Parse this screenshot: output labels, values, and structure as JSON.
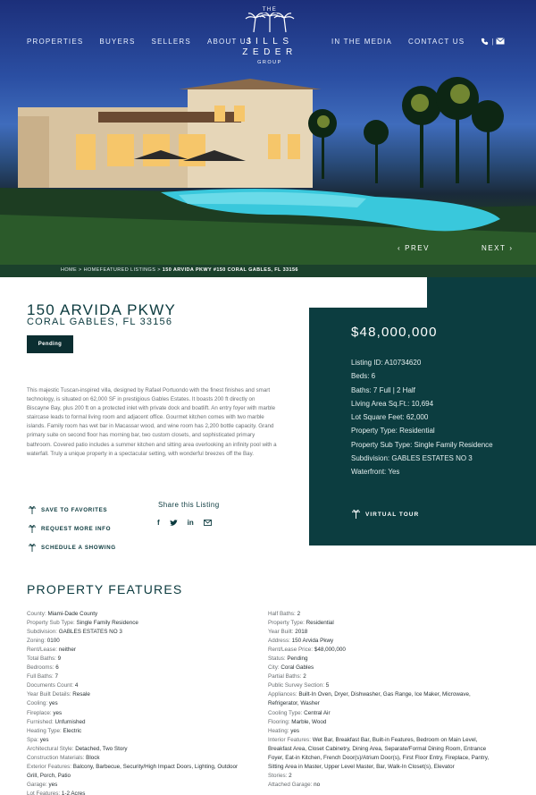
{
  "nav": {
    "left": [
      "PROPERTIES",
      "BUYERS",
      "SELLERS",
      "ABOUT US"
    ],
    "right": [
      "IN THE MEDIA",
      "CONTACT US"
    ],
    "separator": "|",
    "icons": [
      "phone-icon",
      "mail-icon"
    ]
  },
  "logo": {
    "the": "THE",
    "line1": "JILLS",
    "line2": "ZEDER",
    "group": "GROUP"
  },
  "hero": {
    "prev": "PREV",
    "next": "NEXT"
  },
  "breadcrumb": {
    "home": "HOME",
    "sep1": " > ",
    "featured": "HOMEFEATURED LISTINGS",
    "sep2": " > ",
    "current": "150 ARVIDA PKWY #150 CORAL GABLES, FL 33156"
  },
  "listing": {
    "address_line1": "150 ARVIDA PKWY",
    "address_line2": "CORAL GABLES, FL 33156",
    "status_badge": "Pending",
    "description": "This majestic Tuscan-inspired villa, designed by Rafael Portuondo with the finest finishes and smart technology, is situated on 62,000 SF in prestigious Gables Estates. It boasts 200 ft directly on Biscayne Bay, plus 200 ft on a protected inlet with private dock and boatlift. An entry foyer with marble staircase leads to formal living room and adjacent office. Gourmet kitchen comes with two marble islands. Family room has wet bar in Macassar wood, and wine room has 2,200 bottle capacity. Grand primary suite on second floor has morning bar, two custom closets, and sophisticated primary bathroom. Covered patio includes a summer kitchen and sitting area overlooking an infinity pool with a waterfall. Truly a unique property in a spectacular setting, with wonderful breezes off the Bay."
  },
  "actions": {
    "save": "SAVE TO FAVORITES",
    "request": "REQUEST MORE INFO",
    "schedule": "SCHEDULE A SHOWING"
  },
  "share": {
    "title": "Share this Listing",
    "icons": [
      "facebook-icon",
      "twitter-icon",
      "linkedin-icon",
      "email-icon"
    ]
  },
  "panel": {
    "price": "$48,000,000",
    "facts": [
      "Listing ID: A10734620",
      "Beds: 6",
      "Baths: 7 Full | 2 Half",
      "Living Area Sq.Ft.: 10,694",
      "Lot Square Feet: 62,000",
      "Property Type: Residential",
      "Property Sub Type: Single Family Residence",
      "Subdivision: GABLES ESTATES NO 3",
      "Waterfront: Yes"
    ],
    "virtual_tour": "VIRTUAL TOUR"
  },
  "features": {
    "title": "PROPERTY FEATURES",
    "left": [
      {
        "k": "County:",
        "v": "Miami-Dade County"
      },
      {
        "k": "Property Sub Type:",
        "v": "Single Family Residence"
      },
      {
        "k": "Subdivision:",
        "v": "GABLES ESTATES NO 3"
      },
      {
        "k": "Zoning:",
        "v": "0100"
      },
      {
        "k": "Rent/Lease:",
        "v": "neither"
      },
      {
        "k": "Total Baths:",
        "v": "9"
      },
      {
        "k": "Bedrooms:",
        "v": "6"
      },
      {
        "k": "Full Baths:",
        "v": "7"
      },
      {
        "k": "Documents Count:",
        "v": "4"
      },
      {
        "k": "Year Built Details:",
        "v": "Resale"
      },
      {
        "k": "Cooling:",
        "v": "yes"
      },
      {
        "k": "Fireplace:",
        "v": "yes"
      },
      {
        "k": "Furnished:",
        "v": "Unfurnished"
      },
      {
        "k": "Heating Type:",
        "v": "Electric"
      },
      {
        "k": "Spa:",
        "v": "yes"
      },
      {
        "k": "Architectural Style:",
        "v": "Detached, Two Story"
      },
      {
        "k": "Construction Materials:",
        "v": "Block"
      },
      {
        "k": "Exterior Features:",
        "v": "Balcony, Barbecue, Security/High Impact Doors, Lighting, Outdoor Grill, Porch, Patio"
      },
      {
        "k": "Garage:",
        "v": "yes"
      },
      {
        "k": "Lot Features:",
        "v": "1-2 Acres"
      }
    ],
    "right": [
      {
        "k": "Half Baths:",
        "v": "2"
      },
      {
        "k": "Property Type:",
        "v": "Residential"
      },
      {
        "k": "Year Built:",
        "v": "2018"
      },
      {
        "k": "Address:",
        "v": "150 Arvida Pkwy"
      },
      {
        "k": "Rent/Lease Price:",
        "v": "$48,000,000"
      },
      {
        "k": "Status:",
        "v": "Pending"
      },
      {
        "k": "City:",
        "v": "Coral Gables"
      },
      {
        "k": "Partial Baths:",
        "v": "2"
      },
      {
        "k": "Public Survey Section:",
        "v": "5"
      },
      {
        "k": "Appliances:",
        "v": "Built-In Oven, Dryer, Dishwasher, Gas Range, Ice Maker, Microwave, Refrigerator, Washer"
      },
      {
        "k": "Cooling Type:",
        "v": "Central Air"
      },
      {
        "k": "Flooring:",
        "v": "Marble, Wood"
      },
      {
        "k": "Heating:",
        "v": "yes"
      },
      {
        "k": "Interior Features:",
        "v": "Wet Bar, Breakfast Bar, Built-in Features, Bedroom on Main Level, Breakfast Area, Closet Cabinetry, Dining Area, Separate/Formal Dining Room, Entrance Foyer, Eat-in Kitchen, French Door(s)/Atrium Door(s), First Floor Entry, Fireplace, Pantry, Sitting Area in Master, Upper Level Master, Bar, Walk-In Closet(s), Elevator"
      },
      {
        "k": "Stories:",
        "v": "2"
      },
      {
        "k": "Attached Garage:",
        "v": "no"
      }
    ]
  }
}
